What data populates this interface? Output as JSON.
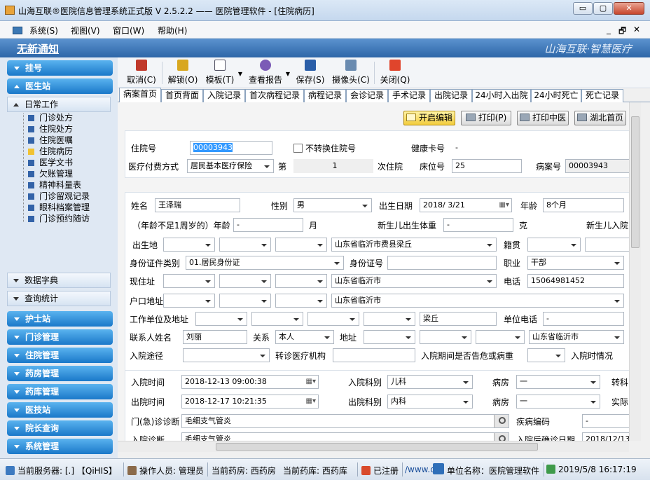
{
  "window": {
    "title": "山海互联®医院信息管理系统正式版 V 2.5.2.2 —— 医院管理软件 - [住院病历]",
    "min": "▭",
    "max": "▢",
    "close": "✕"
  },
  "menu": {
    "items": [
      "系统(S)",
      "视图(V)",
      "窗口(W)",
      "帮助(H)"
    ],
    "right": [
      "_",
      "🗗",
      "✕"
    ]
  },
  "banner": {
    "notice": "无新通知",
    "slogan": "山海互联·智慧医疗"
  },
  "sidebar": {
    "top": [
      {
        "label": "挂号"
      },
      {
        "label": "医生站"
      }
    ],
    "group_open": "日常工作",
    "tree": [
      "门诊处方",
      "住院处方",
      "住院医嘱",
      "住院病历",
      "医学文书",
      "欠账管理",
      "精神科量表",
      "门诊留观记录",
      "眼科档案管理",
      "门诊预约随访"
    ],
    "groups": [
      "数据字典",
      "查询统计"
    ],
    "bottom": [
      "护士站",
      "门诊管理",
      "住院管理",
      "药房管理",
      "药库管理",
      "医技站",
      "院长查询",
      "系统管理"
    ]
  },
  "toolbar": {
    "buttons": [
      "取消(C)",
      "解锁(O)",
      "模板(T)",
      "查看报告",
      "保存(S)",
      "摄像头(C)",
      "关闭(Q)"
    ]
  },
  "tabs": [
    "病案首页",
    "首页背面",
    "入院记录",
    "首次病程记录",
    "病程记录",
    "会诊记录",
    "手术记录",
    "出院记录",
    "24小时入出院",
    "24小时死亡",
    "死亡记录"
  ],
  "actions": [
    "开启编辑",
    "打印(P)",
    "打印中医",
    "湖北首页"
  ],
  "form": {
    "labels": {
      "inpatient_no": "住院号",
      "no_convert": "不转换住院号",
      "health_card": "健康卡号",
      "pay_method": "医疗付费方式",
      "di": "第",
      "times_suffix": "次住院",
      "bed_no": "床位号",
      "case_no": "病案号",
      "name": "姓名",
      "sex": "性别",
      "birth_date": "出生日期",
      "age": "年龄",
      "infant_age": "（年龄不足1周岁的）年龄",
      "month": "月",
      "nb_weight": "新生儿出生体重",
      "gram": "克",
      "nb_admit": "新生儿入院",
      "birthplace": "出生地",
      "native": "籍贯",
      "id_type": "身份证件类别",
      "id_no": "身份证号",
      "job": "职业",
      "address": "现住址",
      "phone": "电话",
      "hukou": "户口地址",
      "work": "工作单位及地址",
      "work_phone": "单位电话",
      "contact": "联系人姓名",
      "relation": "关系",
      "contact_addr": "地址",
      "admit_route": "入院途径",
      "transfer": "转诊医疗机构",
      "critical": "入院期间是否告危或病重",
      "admit_status": "入院时情况",
      "admit_time": "入院时间",
      "admit_dept": "入院科别",
      "ward": "病房",
      "transfer_dept": "转科",
      "discharge_time": "出院时间",
      "discharge_dept": "出院科别",
      "ward2": "病房",
      "actual": "实际",
      "er_dx": "门(急)诊诊断",
      "disease_code": "疾病编码",
      "admit_dx": "入院诊断",
      "confirm_date": "入院后确诊日期"
    },
    "values": {
      "inpatient_no": "00003943",
      "health_card": "-",
      "pay_method": "居民基本医疗保险",
      "times": "1",
      "bed_no": "25",
      "case_no": "00003943",
      "name": "王泽瑞",
      "sex": "男",
      "birth_date": "2018/ 3/21",
      "age": "8个月",
      "infant_age": "-",
      "nb_weight": "-",
      "birthplace": "山东省临沂市费县梁丘",
      "id_type": "01.居民身份证",
      "job": "干部",
      "address": "山东省临沂市",
      "phone": "15064981452",
      "hukou": "山东省临沂市",
      "work": "梁丘",
      "work_phone": "-",
      "contact": "刘丽",
      "relation": "本人",
      "contact_addr": "山东省临沂市",
      "admit_time": "2018-12-13 09:00:38",
      "admit_dept": "儿科",
      "ward": "一",
      "discharge_time": "2018-12-17 10:21:35",
      "discharge_dept": "内科",
      "ward2": "一",
      "er_dx": "毛细支气管炎",
      "disease_code": "-",
      "admit_dx": "毛细支气管炎",
      "confirm_date": "2018/12/13"
    }
  },
  "status": {
    "server_label": "当前服务器:",
    "server": "[.]  【QiHIS】",
    "operator_label": "操作人员:",
    "operator": "管理员",
    "pharmacy_label": "当前药房:",
    "pharmacy": "西药房",
    "store_label": "当前药库:",
    "store": "西药库",
    "registered": "已注册",
    "url": "/www.q",
    "unit_label": "单位名称：",
    "unit": "医院管理软件",
    "datetime": "2019/5/8 16:17:19"
  }
}
